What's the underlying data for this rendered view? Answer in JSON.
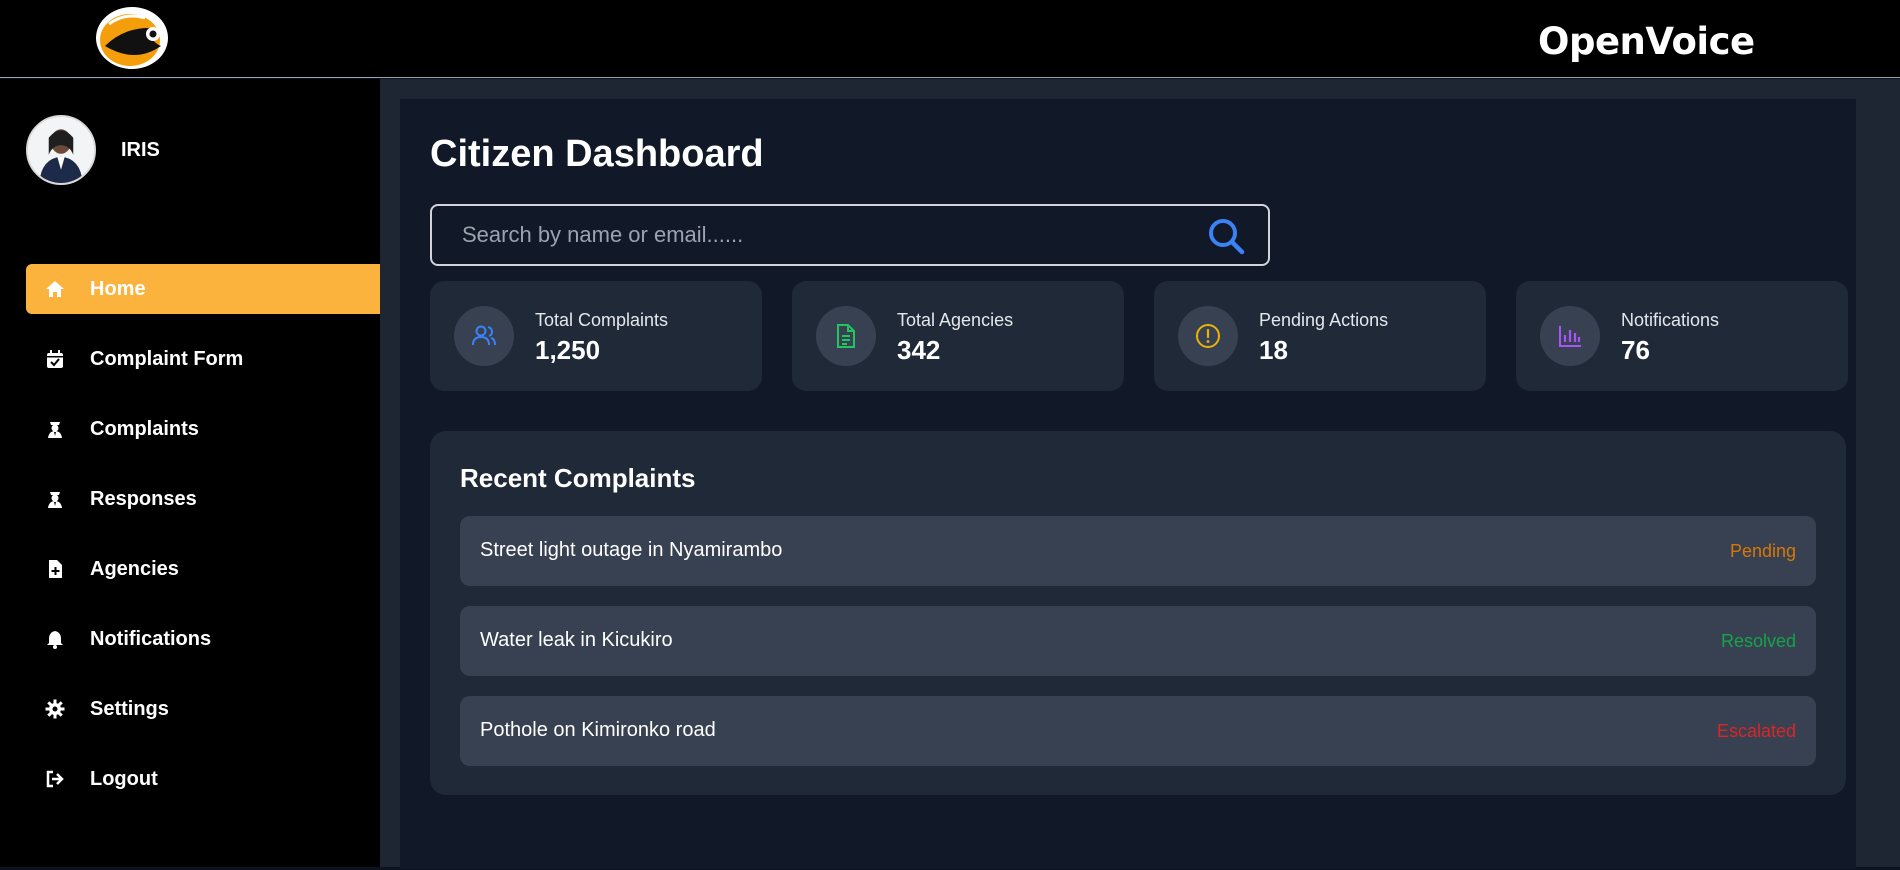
{
  "header": {
    "brand": "OpenVoice"
  },
  "user": {
    "name": "IRIS"
  },
  "sidebar": {
    "items": [
      {
        "label": "Home",
        "icon": "home-icon"
      },
      {
        "label": "Complaint Form",
        "icon": "calendar-check-icon"
      },
      {
        "label": "Complaints",
        "icon": "user-officer-icon"
      },
      {
        "label": "Responses",
        "icon": "user-officer-icon"
      },
      {
        "label": "Agencies",
        "icon": "file-plus-icon"
      },
      {
        "label": "Notifications",
        "icon": "bell-icon"
      },
      {
        "label": "Settings",
        "icon": "gear-icon"
      },
      {
        "label": "Logout",
        "icon": "logout-icon"
      }
    ]
  },
  "main": {
    "title": "Citizen Dashboard",
    "search": {
      "placeholder": "Search by name or email......",
      "value": ""
    },
    "stats": [
      {
        "label": "Total Complaints",
        "value": "1,250",
        "icon": "users-icon",
        "color": "#3b82f6"
      },
      {
        "label": "Total Agencies",
        "value": "342",
        "icon": "document-icon",
        "color": "#22c55e"
      },
      {
        "label": "Pending Actions",
        "value": "18",
        "icon": "alert-circle-icon",
        "color": "#eab308"
      },
      {
        "label": "Notifications",
        "value": "76",
        "icon": "bar-chart-icon",
        "color": "#a855f7"
      }
    ],
    "recent": {
      "title": "Recent Complaints",
      "items": [
        {
          "text": "Street light outage in Nyamirambo",
          "status": "Pending",
          "color": "#d97706"
        },
        {
          "text": "Water leak in Kicukiro",
          "status": "Resolved",
          "color": "#16a34a"
        },
        {
          "text": "Pothole on Kimironko road",
          "status": "Escalated",
          "color": "#dc2626"
        }
      ]
    }
  },
  "colors": {
    "accent": "#fbb33e",
    "search_icon": "#3b82f6"
  }
}
